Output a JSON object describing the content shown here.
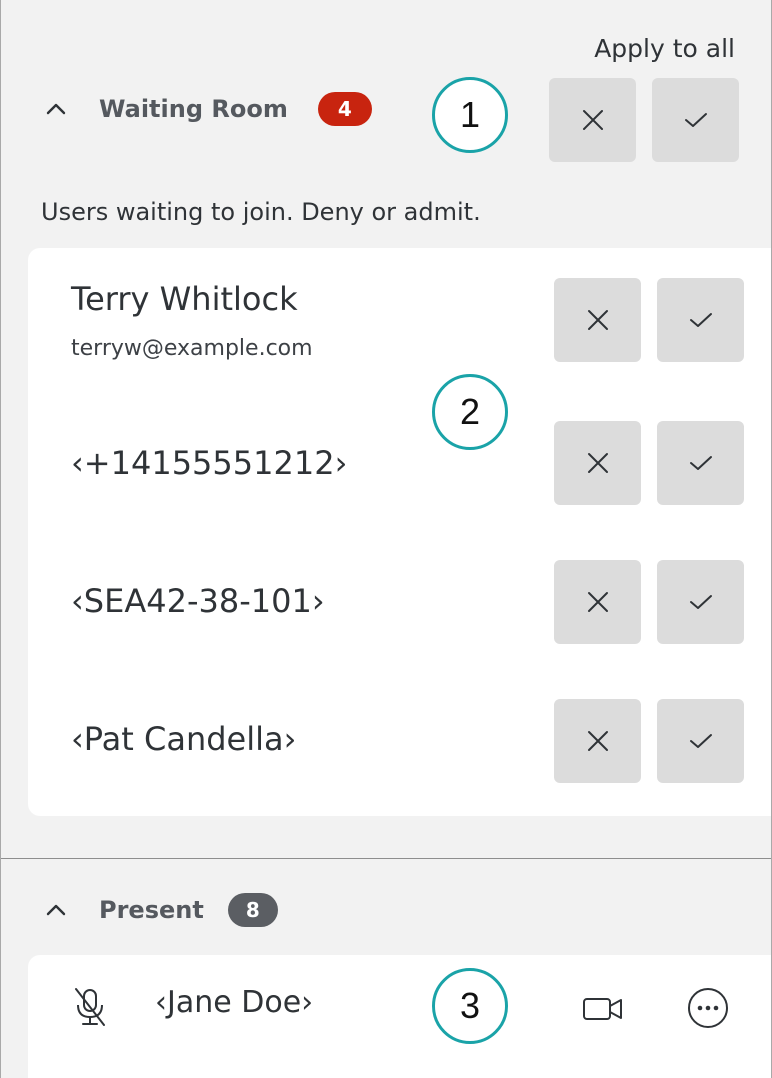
{
  "apply_all_label": "Apply to all",
  "waiting_room": {
    "title": "Waiting Room",
    "count": "4",
    "helper_text": "Users waiting to join. Deny or admit.",
    "users": [
      {
        "name": "Terry Whitlock",
        "email": "terryw@example.com"
      },
      {
        "name": "‹+14155551212›"
      },
      {
        "name": "‹SEA42-38-101›"
      },
      {
        "name": "‹Pat Candella›"
      }
    ]
  },
  "present": {
    "title": "Present",
    "count": "8",
    "attendees": [
      {
        "name": "‹Jane Doe›"
      }
    ]
  },
  "callouts": [
    "1",
    "2",
    "3"
  ],
  "colors": {
    "panel_bg": "#f2f2f2",
    "badge_red": "#c8240f",
    "badge_gray": "#5b5e63",
    "button_bg": "#dcdcdc",
    "callout_ring": "#1aa3a8"
  },
  "icons": {
    "collapse": "chevron-up-icon",
    "deny": "close-icon",
    "admit": "check-icon",
    "mic": "mic-off-icon",
    "camera": "video-camera-icon",
    "more": "more-options-icon"
  }
}
